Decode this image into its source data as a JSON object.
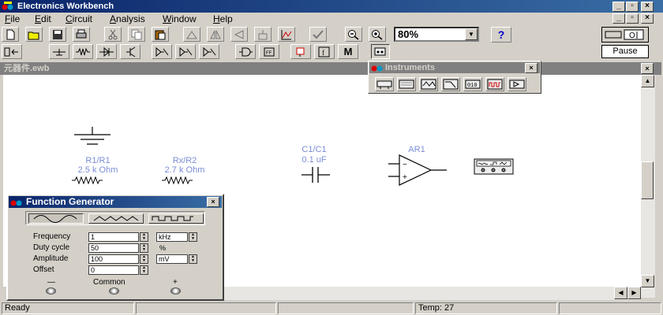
{
  "window": {
    "title": "Electronics Workbench"
  },
  "menu": [
    {
      "label": "File",
      "u": "F",
      "rest": "ile"
    },
    {
      "label": "Edit",
      "u": "E",
      "rest": "dit"
    },
    {
      "label": "Circuit",
      "u": "C",
      "rest": "ircuit"
    },
    {
      "label": "Analysis",
      "u": "A",
      "rest": "nalysis"
    },
    {
      "label": "Window",
      "u": "W",
      "rest": "indow"
    },
    {
      "label": "Help",
      "u": "H",
      "rest": "elp"
    }
  ],
  "toolbar": {
    "zoom_value": "80%",
    "help_label": "?",
    "pause_label": "Pause",
    "parts_m_label": "M"
  },
  "document": {
    "title": "元器件.ewb"
  },
  "components": {
    "r1": {
      "name": "R1/R1",
      "value": "2.5 k Ohm"
    },
    "rx": {
      "name": "Rx/R2",
      "value": "2.7 k Ohm"
    },
    "c1": {
      "name": "C1/C1",
      "value": "0.1 uF"
    },
    "ar1": {
      "name": "AR1"
    }
  },
  "instruments": {
    "title": "Instruments"
  },
  "function_generator": {
    "title": "Function Generator",
    "waveforms": [
      "sine",
      "triangle",
      "square"
    ],
    "selected_waveform": "sine",
    "fields": {
      "frequency": {
        "label": "Frequency",
        "value": "1",
        "unit": "kHz"
      },
      "duty_cycle": {
        "label": "Duty cycle",
        "value": "50",
        "unit": "%"
      },
      "amplitude": {
        "label": "Amplitude",
        "value": "100",
        "unit": "mV"
      },
      "offset": {
        "label": "Offset",
        "value": "0"
      }
    },
    "terminals": {
      "minus": "—",
      "common": "Common",
      "plus": "+"
    }
  },
  "status": {
    "ready": "Ready",
    "temp": "Temp:  27"
  }
}
